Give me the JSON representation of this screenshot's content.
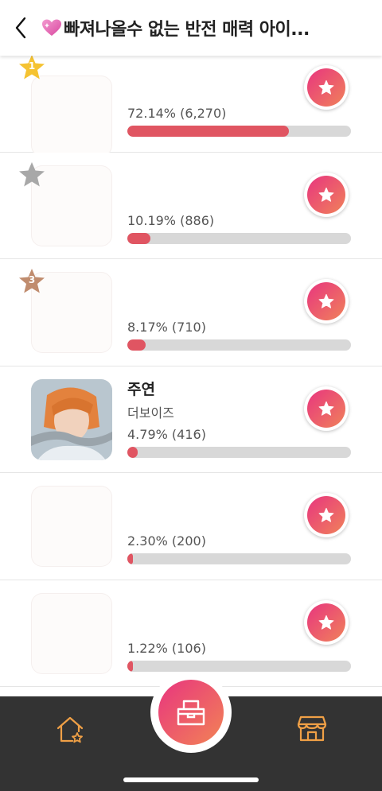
{
  "header": {
    "title": "빠져나올수 없는 반전 매력 아이...",
    "back_icon": "chevron-left-icon",
    "title_icon": "sparkling-heart-icon"
  },
  "entries": [
    {
      "rank_label": "1",
      "name": "",
      "group": "",
      "percent_text": "72.14% (6,270)",
      "share": 0.7214,
      "badge_color": "#f5c332"
    },
    {
      "rank_label": "",
      "name": "",
      "group": "",
      "percent_text": "10.19% (886)",
      "share": 0.1019,
      "badge_color": "#a8a8a8"
    },
    {
      "rank_label": "3",
      "name": "",
      "group": "",
      "percent_text": "8.17% (710)",
      "share": 0.0817,
      "badge_color": "#c08c6e"
    },
    {
      "rank_label": "",
      "name": "주연",
      "group": "더보이즈",
      "percent_text": "4.79% (416)",
      "share": 0.0479
    },
    {
      "rank_label": "",
      "name": "",
      "group": "",
      "percent_text": "2.30% (200)",
      "share": 0.023
    },
    {
      "rank_label": "",
      "name": "",
      "group": "",
      "percent_text": "1.22% (106)",
      "share": 0.0122
    }
  ],
  "colors": {
    "bar_fill": "#e05562",
    "bar_track": "#d8d8d8",
    "accent_start": "#e8357f",
    "accent_end": "#f0825a",
    "tabbar": "#333333",
    "tab_icon": "#f0a046"
  },
  "tabbar": {
    "home_icon": "home-star-icon",
    "center_icon": "ballot-box-icon",
    "shop_icon": "storefront-icon"
  }
}
